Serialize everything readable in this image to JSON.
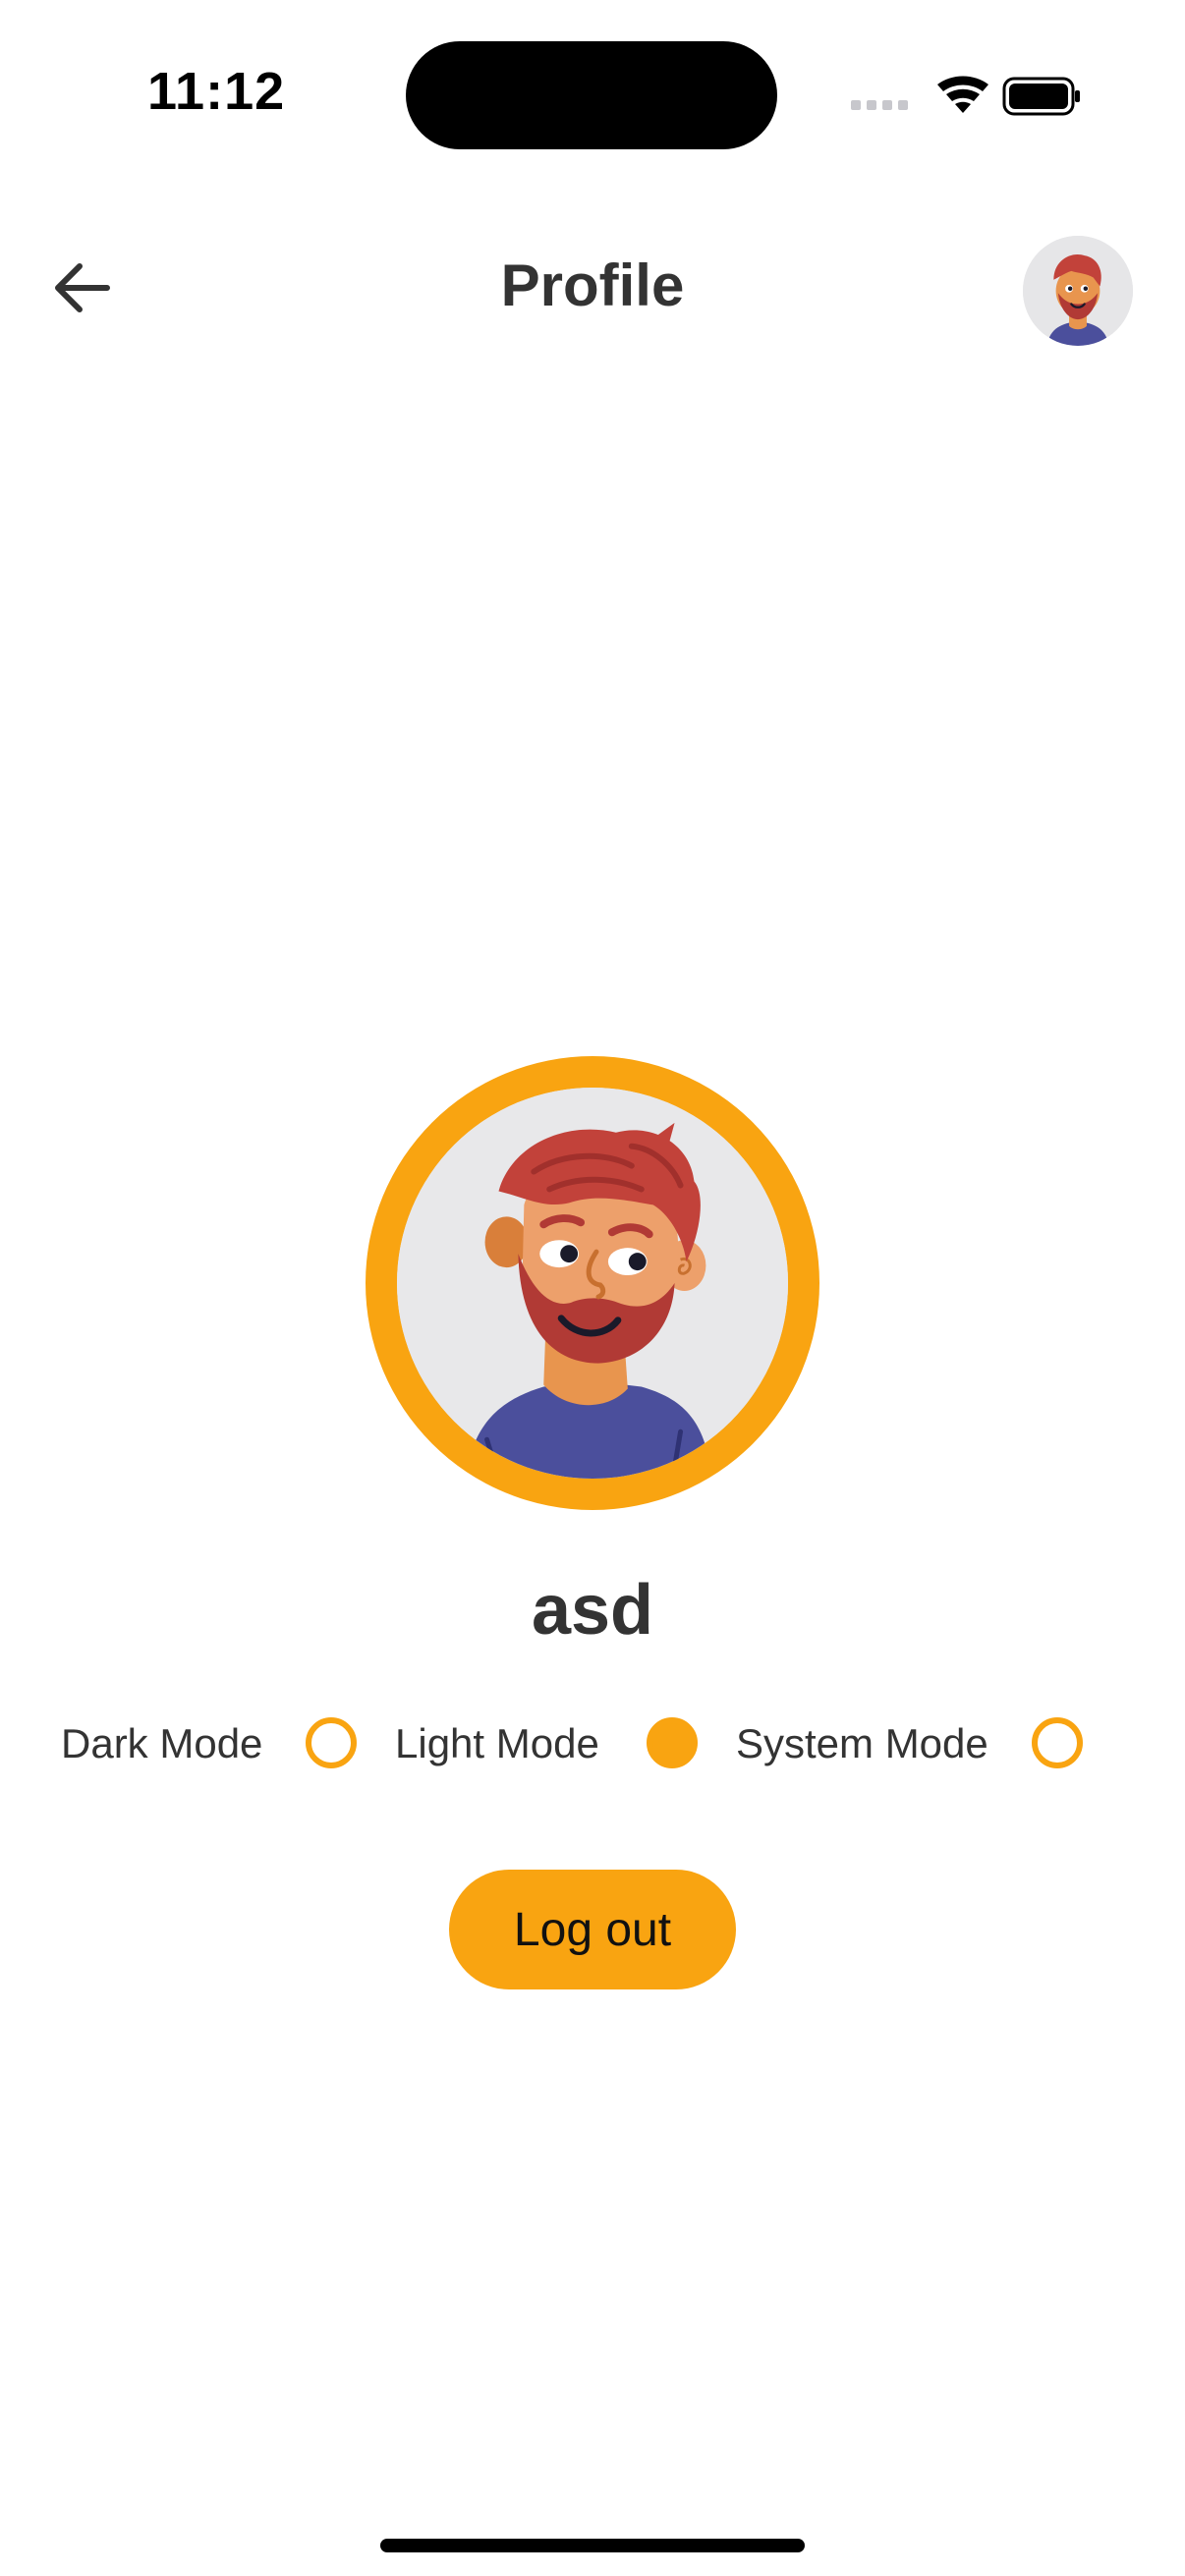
{
  "status_bar": {
    "time": "11:12",
    "icons": [
      "cellular-signal-icon",
      "wifi-icon",
      "battery-icon"
    ]
  },
  "header": {
    "back_icon": "arrow-left-icon",
    "title": "Profile",
    "avatar_icon": "user-avatar-illustration"
  },
  "profile": {
    "avatar_icon": "user-avatar-illustration",
    "username": "asd"
  },
  "theme": {
    "options": [
      {
        "label": "Dark Mode",
        "selected": false
      },
      {
        "label": "Light Mode",
        "selected": true
      },
      {
        "label": "System Mode",
        "selected": false
      }
    ]
  },
  "actions": {
    "logout_label": "Log out"
  },
  "colors": {
    "accent": "#f9a411",
    "text": "#333333",
    "background": "#ffffff",
    "avatar_bg": "#e8e8ea"
  }
}
